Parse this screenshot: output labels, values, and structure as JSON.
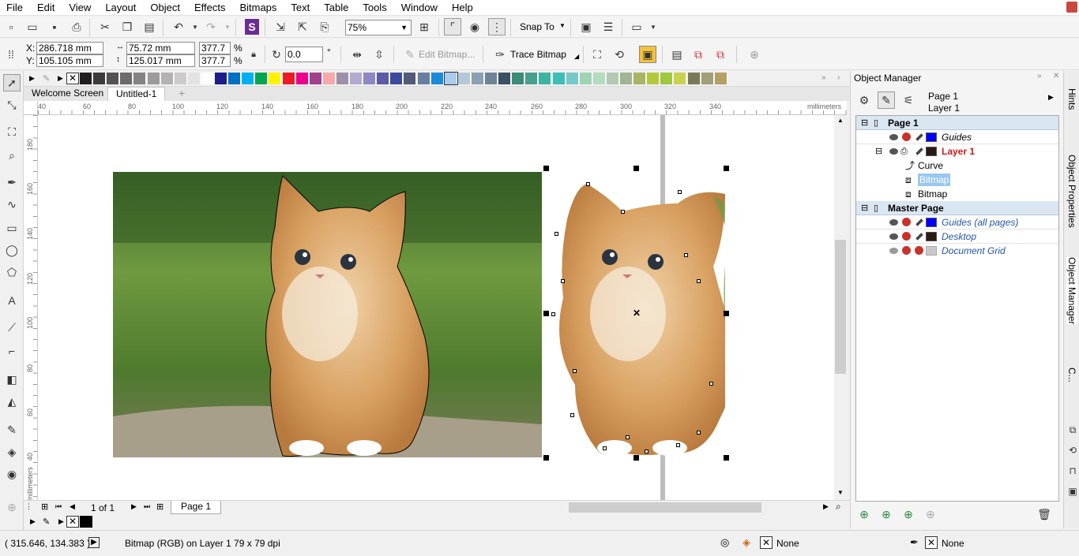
{
  "menu": {
    "items": [
      "File",
      "Edit",
      "View",
      "Layout",
      "Object",
      "Effects",
      "Bitmaps",
      "Text",
      "Table",
      "Tools",
      "Window",
      "Help"
    ]
  },
  "standard_toolbar": {
    "zoom_level": "75%",
    "snap_to_label": "Snap To"
  },
  "property_bar": {
    "x_label": "X:",
    "x_value": "286.718 mm",
    "y_label": "Y:",
    "y_value": "105.105 mm",
    "width_value": "75.72 mm",
    "height_value": "125.017 mm",
    "scale_x": "377.7",
    "scale_y": "377.7",
    "percent_x": "%",
    "percent_y": "%",
    "rotation_value": "0.0",
    "degree_sign": "°",
    "edit_bitmap_label": "Edit Bitmap...",
    "trace_bitmap_label": "Trace Bitmap"
  },
  "palette": {
    "colors": [
      "#231f20",
      "#3d3a3b",
      "#555253",
      "#6d6a6b",
      "#858283",
      "#9d9a9b",
      "#b5b2b3",
      "#cdcacb",
      "#e5e2e3",
      "#ffffff",
      "#1d1d8c",
      "#0070c0",
      "#00b0f0",
      "#00a651",
      "#fff200",
      "#ed1c24",
      "#ec008c",
      "#a0408c",
      "#f7a8a8",
      "#9e8fa8",
      "#b4aad0",
      "#8e88c4",
      "#5a5aa8",
      "#3c4aa0",
      "#525a78",
      "#6a7ea0",
      "#1a8cdc",
      "#aaccee",
      "#b4c8d8",
      "#8aa0b4",
      "#6e8496",
      "#3a5064",
      "#3c8c78",
      "#46a08c",
      "#3cb4a0",
      "#3cbeb4",
      "#78c8c8",
      "#a0d2b4",
      "#b4dcbe",
      "#b4c8b4",
      "#a0b496",
      "#aab464",
      "#b4c83c",
      "#a0c83c",
      "#c8d250",
      "#7a7a58",
      "#a0a078",
      "#b4a064"
    ],
    "selected_index": 27
  },
  "tabs": {
    "welcome": "Welcome Screen",
    "document": "Untitled-1",
    "add": "+"
  },
  "ruler": {
    "unit": "millimeters",
    "h_ticks": [
      "40",
      "60",
      "80",
      "100",
      "120",
      "140",
      "160",
      "180",
      "200",
      "220",
      "240",
      "260",
      "280",
      "300",
      "320",
      "340"
    ],
    "v_ticks": [
      "180",
      "160",
      "140",
      "120",
      "100",
      "80",
      "60",
      "40"
    ]
  },
  "page_nav": {
    "page_count": "1 of 1",
    "page_tab": "Page 1"
  },
  "object_manager": {
    "title": "Object Manager",
    "current_page": "Page 1",
    "current_layer": "Layer 1",
    "tree": [
      {
        "label": "Page 1",
        "type": "page-head"
      },
      {
        "label": "Guides",
        "type": "layer",
        "color": "#0000ff",
        "style": "italic"
      },
      {
        "label": "Layer 1",
        "type": "layer-active",
        "color": "#2a1a14",
        "style": "bold-red"
      },
      {
        "label": "Curve",
        "type": "object"
      },
      {
        "label": "Bitmap",
        "type": "object-selected"
      },
      {
        "label": "Bitmap",
        "type": "object"
      },
      {
        "label": "Master Page",
        "type": "page-head"
      },
      {
        "label": "Guides (all pages)",
        "type": "layer",
        "color": "#0000ff",
        "style": "italic-blue"
      },
      {
        "label": "Desktop",
        "type": "layer",
        "color": "#2a1a14",
        "style": "italic-blue"
      },
      {
        "label": "Document Grid",
        "type": "layer",
        "color": "#c8c8c8",
        "style": "italic-blue"
      }
    ]
  },
  "dock_tabs": {
    "hints": "Hints",
    "object_properties": "Object Properties",
    "object_manager": "Object Manager",
    "c": "C..."
  },
  "status": {
    "coords": "( 315.646, 134.383 )",
    "info": "Bitmap (RGB) on Layer 1 79 x 79 dpi",
    "fill_label": "None",
    "outline_label": "None"
  }
}
